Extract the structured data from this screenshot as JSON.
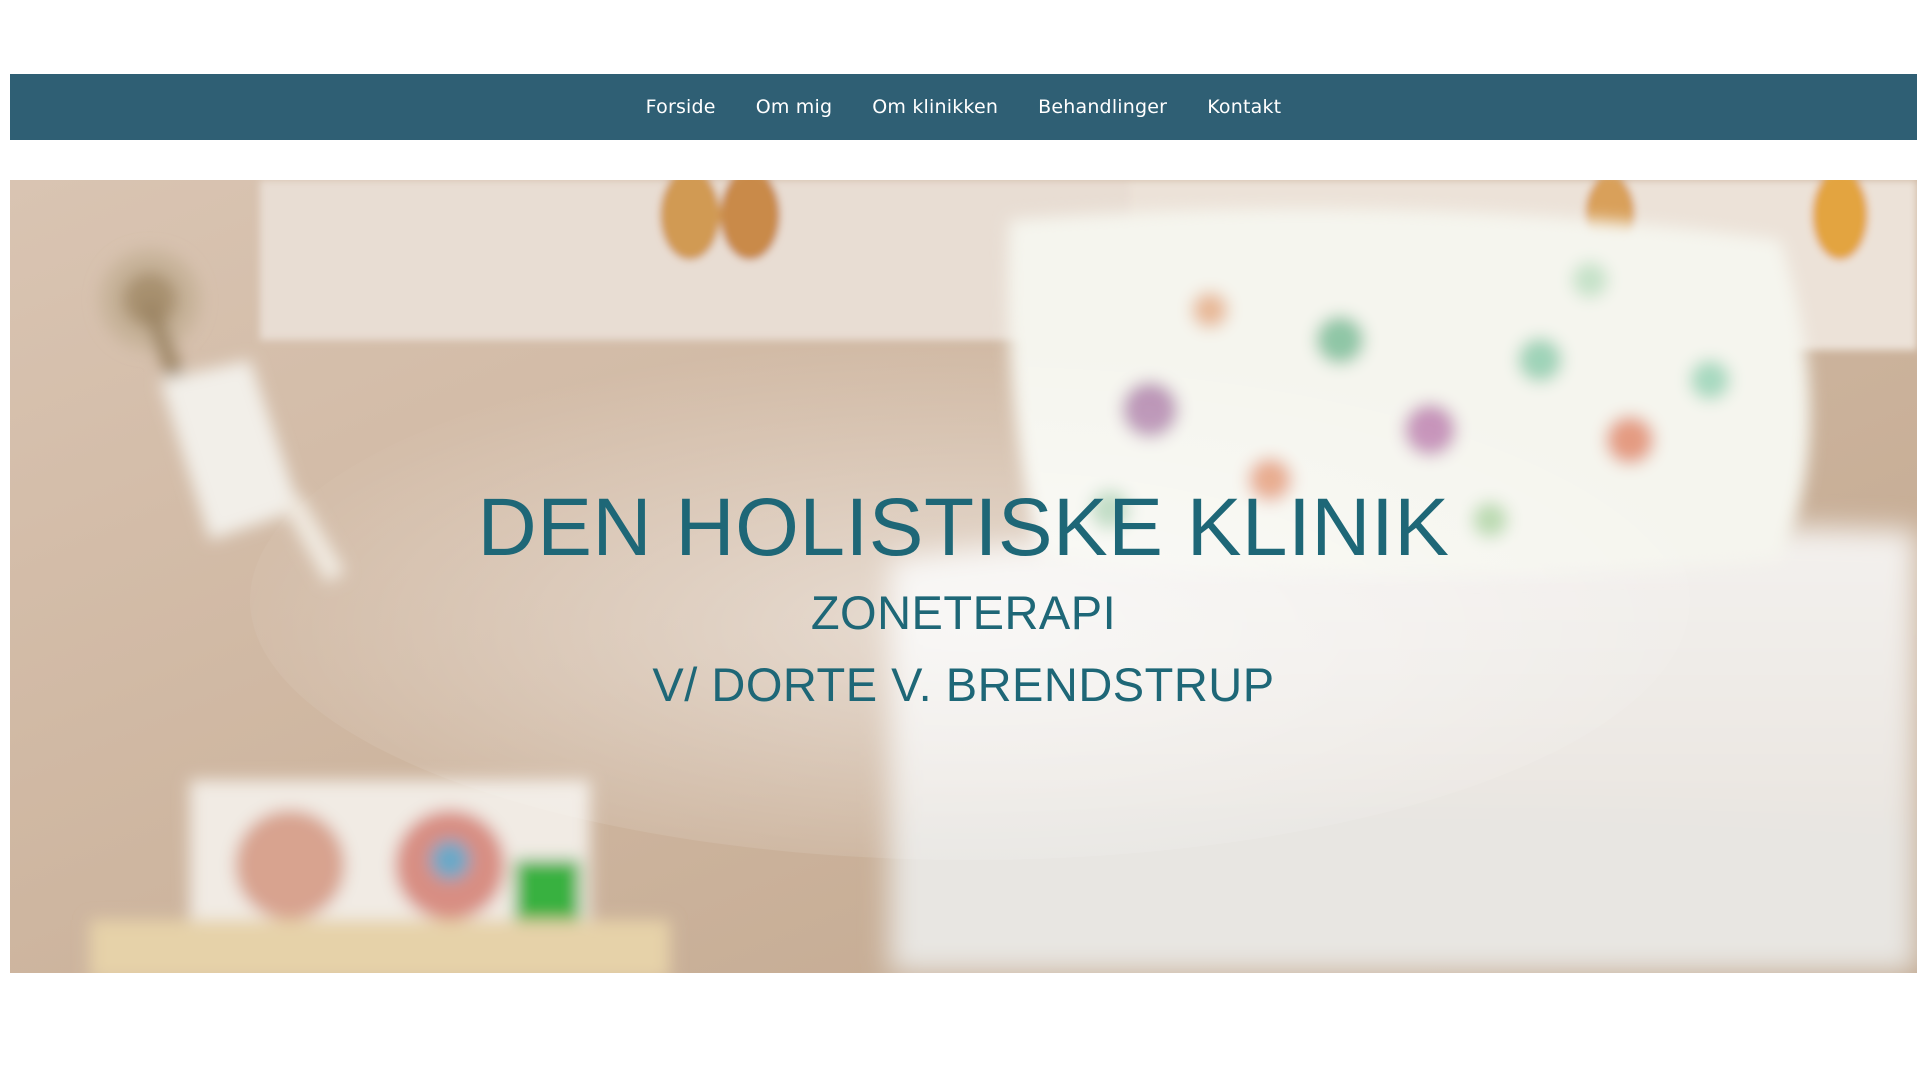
{
  "nav": {
    "items": [
      {
        "label": "Forside"
      },
      {
        "label": "Om mig"
      },
      {
        "label": "Om klinikken"
      },
      {
        "label": "Behandlinger"
      },
      {
        "label": "Kontakt"
      }
    ],
    "background": "#2f5f74"
  },
  "hero": {
    "title": "DEN HOLISTISKE KLINIK",
    "subtitle": "ZONETERAPI",
    "tagline": "V/ DORTE V. BRENDSTRUP",
    "text_color": "#1e6777"
  }
}
